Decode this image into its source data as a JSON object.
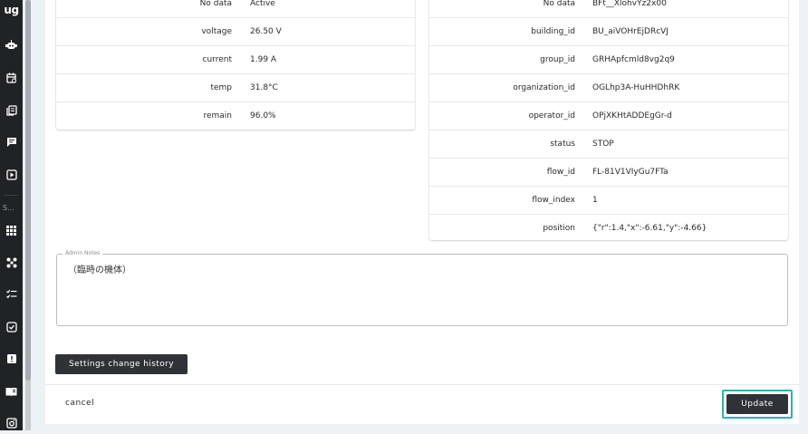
{
  "sidebar": {
    "logo": "ug",
    "section_label": "S...",
    "icons": [
      "robot-icon",
      "calendar-icon",
      "document-icon",
      "chat-icon",
      "play-icon",
      "grid-icon",
      "drone-icon",
      "checklist-icon",
      "check-square-icon",
      "alert-icon",
      "book-icon",
      "camera-icon"
    ]
  },
  "left_table": {
    "rows": [
      {
        "key": "No data",
        "value": "Active"
      },
      {
        "key": "voltage",
        "value": "26.50 V"
      },
      {
        "key": "current",
        "value": "1.99 A"
      },
      {
        "key": "temp",
        "value": "31.8°C"
      },
      {
        "key": "remain",
        "value": "96.0%"
      }
    ]
  },
  "right_table": {
    "rows": [
      {
        "key": "No data",
        "value": "BFt__XlohvYz2x00"
      },
      {
        "key": "building_id",
        "value": "BU_aiVOHrEjDRcVJ"
      },
      {
        "key": "group_id",
        "value": "GRHApfcmld8vg2q9"
      },
      {
        "key": "organization_id",
        "value": "OGLhp3A-HuHHDhRK"
      },
      {
        "key": "operator_id",
        "value": "OPjXKHtADDEgGr-d"
      },
      {
        "key": "status",
        "value": "STOP"
      },
      {
        "key": "flow_id",
        "value": "FL-81V1VIyGu7FTa"
      },
      {
        "key": "flow_index",
        "value": "1"
      },
      {
        "key": "position",
        "value": "{\"r\":1.4,\"x\":-6.61,\"y\":-4.66}"
      }
    ]
  },
  "notes": {
    "legend": "Admin Notes",
    "value": "（臨時の機体）"
  },
  "buttons": {
    "history": "Settings change history",
    "cancel": "cancel",
    "update": "Update"
  },
  "colors": {
    "dark_button": "#2f3337",
    "highlight": "#2bb3ad"
  }
}
